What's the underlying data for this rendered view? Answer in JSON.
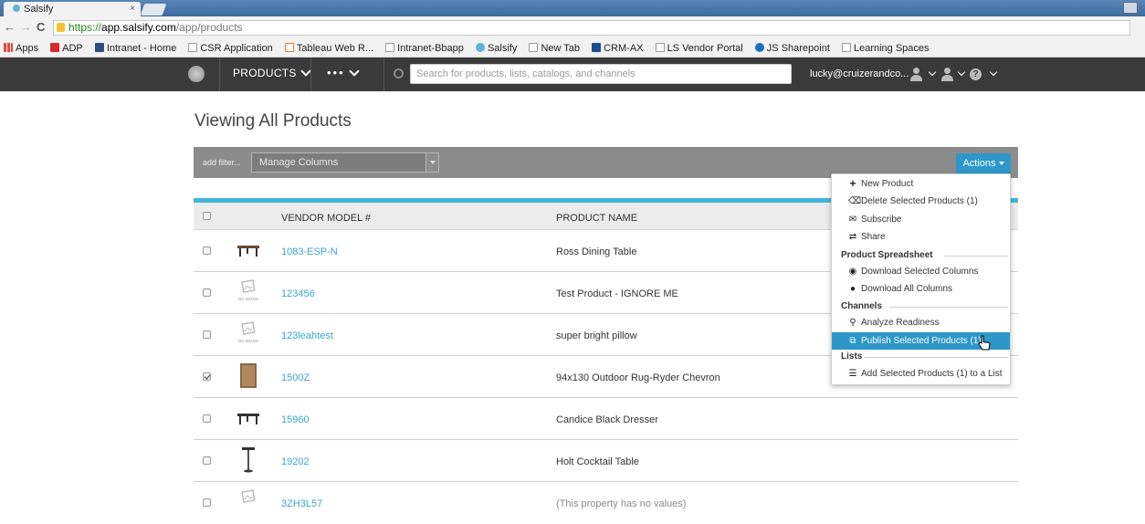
{
  "browser": {
    "tab_title": "Salsify",
    "tab_close": "×",
    "back": "←",
    "forward": "→",
    "reload": "C",
    "url_scheme": "https://",
    "url_host": "app.salsify.com",
    "url_path": "/app/products",
    "bookmarks": [
      "Apps",
      "ADP",
      "Intranet - Home",
      "CSR Application",
      "Tableau Web R...",
      "Intranet-Bbapp",
      "Salsify",
      "New Tab",
      "CRM-AX",
      "LS Vendor Portal",
      "JS Sharepoint",
      "Learning Spaces"
    ]
  },
  "header": {
    "products_label": "PRODUCTS",
    "more_label": "•••",
    "search_placeholder": "Search for products, lists, catalogs, and channels",
    "user_email": "lucky@cruizerandco...",
    "help_glyph": "?"
  },
  "page": {
    "title": "Viewing All Products"
  },
  "toolbar": {
    "add_filter": "add filter...",
    "manage_columns": "Manage Columns",
    "actions_label": "Actions"
  },
  "table": {
    "columns": {
      "model": "VENDOR MODEL #",
      "name": "PRODUCT NAME"
    },
    "rows": [
      {
        "model": "1083-ESP-N",
        "name": "Ross Dining Table",
        "checked": false,
        "thumb": "table"
      },
      {
        "model": "123456",
        "name": "Test Product - IGNORE ME",
        "checked": false,
        "thumb": "noimage",
        "thumb_text": "NO IMAGE"
      },
      {
        "model": "123leahtest",
        "name": "super bright pillow",
        "checked": false,
        "thumb": "noimage",
        "thumb_text": "NO IMAGE"
      },
      {
        "model": "1500Z",
        "name": "94x130 Outdoor Rug-Ryder Chevron",
        "checked": true,
        "thumb": "rug"
      },
      {
        "model": "15960",
        "name": "Candice Black Dresser",
        "checked": false,
        "thumb": "table"
      },
      {
        "model": "19202",
        "name": "Holt Cocktail Table",
        "checked": false,
        "thumb": "cocktail"
      },
      {
        "model": "3ZH3L57",
        "name": "(This property has no values)",
        "checked": false,
        "thumb": "noimage"
      }
    ]
  },
  "actions_menu": {
    "items": {
      "new_product": "New Product",
      "delete_selected": "Delete Selected Products (1)",
      "subscribe": "Subscribe",
      "share": "Share",
      "download_selected": "Download Selected Columns",
      "download_all": "Download All Columns",
      "analyze": "Analyze Readiness",
      "publish": "Publish Selected Products (1)",
      "add_to_list": "Add Selected Products (1) to a List"
    },
    "sections": {
      "spreadsheet": "Product Spreadsheet",
      "channels": "Channels",
      "lists": "Lists"
    }
  },
  "colors": {
    "accent": "#42b7da",
    "link": "#3aa5d5",
    "header_bg": "#3a3a3a",
    "button": "#2d97c9"
  }
}
